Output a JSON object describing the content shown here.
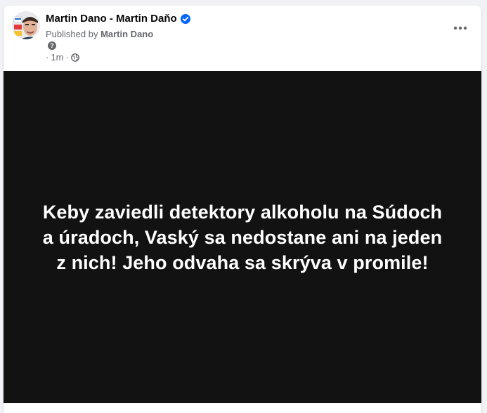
{
  "post": {
    "author": "Martin Dano - Martin Daňo",
    "published_by_prefix": "Published by ",
    "published_by_name": "Martin Dano",
    "time": "1m",
    "separator": "·",
    "icons": {
      "verified": "verified-badge-icon",
      "help": "question-mark-icon",
      "privacy": "globe-icon",
      "more": "more-dots-icon"
    },
    "image_text_lines": [
      "Keby zaviedli detektory alkoholu na Súdoch",
      "a úradoch, Vaský sa nedostane ani na jeden",
      "z nich! Jeho odvaha sa skrýva v promile!"
    ]
  },
  "colors": {
    "verified_blue": "#0866ff",
    "image_background": "#121212",
    "secondary_text": "#65676b"
  }
}
